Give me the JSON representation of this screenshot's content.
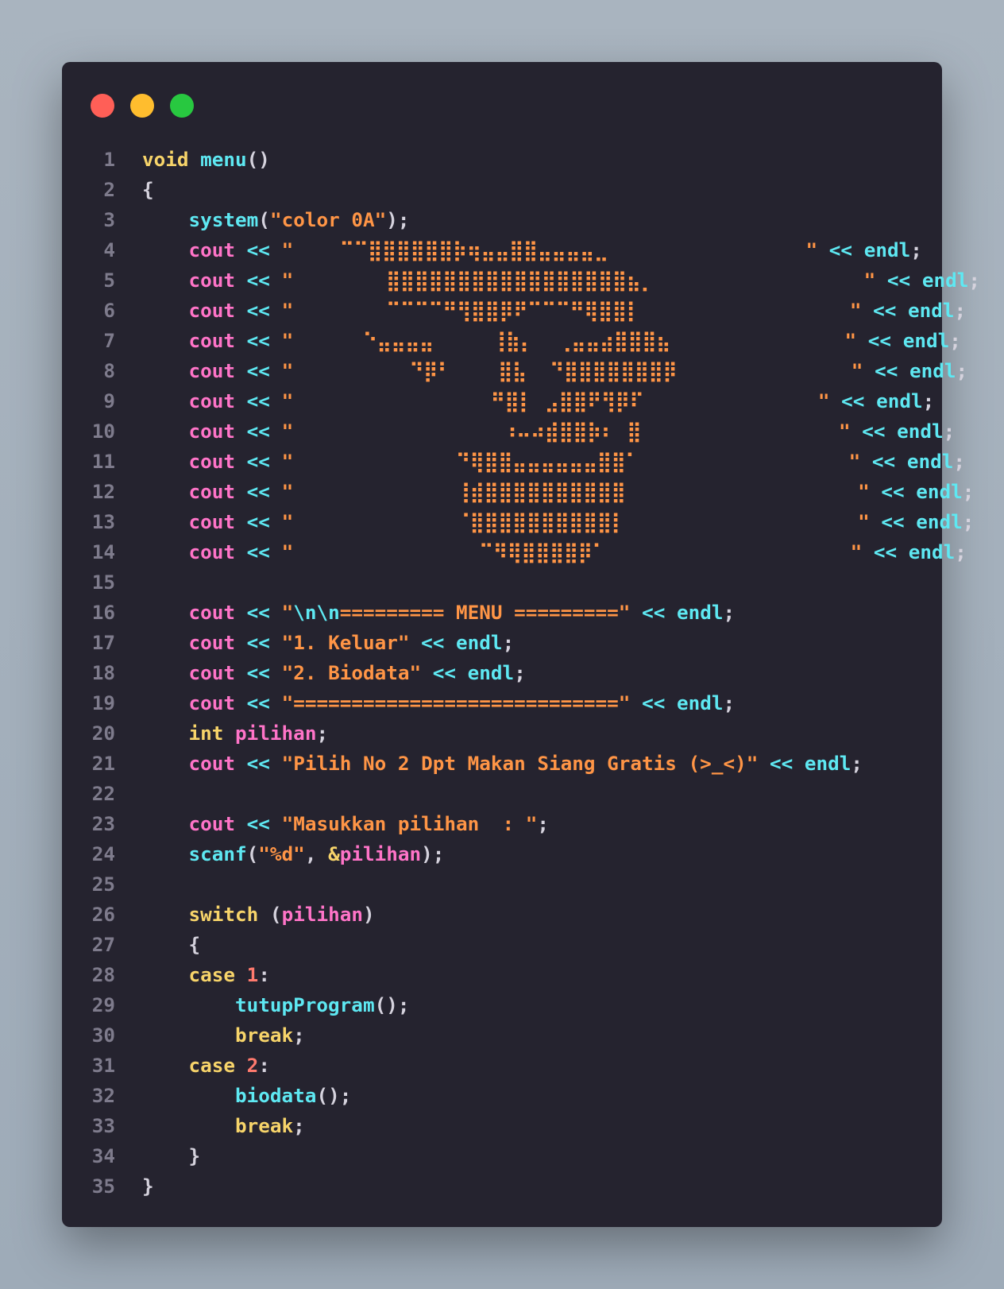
{
  "colors": {
    "background": "#a5b1bd",
    "window": "#25232f",
    "close_dot": "#ff5f57",
    "minimize_dot": "#ffbd2e",
    "zoom_dot": "#28c840",
    "keyword": "#f7d46a",
    "function": "#5ee8f2",
    "stream": "#ff74c8",
    "string": "#ff9546",
    "number": "#ff7a6e",
    "line_number": "#7e7b8c"
  },
  "code": {
    "lines": [
      {
        "n": "1",
        "t": [
          [
            "void",
            "kw"
          ],
          [
            " ",
            "pun"
          ],
          [
            "menu",
            "fn"
          ],
          [
            "()",
            "pun"
          ]
        ]
      },
      {
        "n": "2",
        "t": [
          [
            "{",
            "pun"
          ]
        ]
      },
      {
        "n": "3",
        "t": [
          [
            "    ",
            "pun"
          ],
          [
            "system",
            "fn"
          ],
          [
            "(",
            "pun"
          ],
          [
            "\"color 0A\"",
            "str"
          ],
          [
            ");",
            "pun"
          ]
        ]
      },
      {
        "n": "4",
        "t": [
          [
            "    ",
            "pun"
          ],
          [
            "cout",
            "io"
          ],
          [
            " ",
            "pun"
          ],
          [
            "<<",
            "op"
          ],
          [
            " ",
            "pun"
          ],
          [
            "\"    ⠉⠉⣿⣿⣿⣿⣿⣿⡷⢶⣤⣤⣿⣿⣤⣤⣤⣤⣀                 \"",
            "str"
          ],
          [
            " ",
            "pun"
          ],
          [
            "<<",
            "op"
          ],
          [
            " ",
            "pun"
          ],
          [
            "endl",
            "fn"
          ],
          [
            ";",
            "pun"
          ]
        ]
      },
      {
        "n": "5",
        "t": [
          [
            "    ",
            "pun"
          ],
          [
            "cout",
            "io"
          ],
          [
            " ",
            "pun"
          ],
          [
            "<<",
            "op"
          ],
          [
            " ",
            "pun"
          ],
          [
            "\"        ⣿⣿⣿⣿⣿⣿⣿⣿⣿⣿⣿⣿⣿⣿⣿⣿⣿⣦⡀                  \"",
            "str"
          ],
          [
            " ",
            "pun"
          ],
          [
            "<<",
            "op"
          ],
          [
            " ",
            "pun"
          ],
          [
            "endl",
            "fn"
          ],
          [
            ";",
            "pun"
          ]
        ]
      },
      {
        "n": "6",
        "t": [
          [
            "    ",
            "pun"
          ],
          [
            "cout",
            "io"
          ],
          [
            " ",
            "pun"
          ],
          [
            "<<",
            "op"
          ],
          [
            " ",
            "pun"
          ],
          [
            "\"        ⠉⠉⠉⠉⠛⢻⣿⣿⡿⠟⠉⠉⠉⠛⢿⣿⣿⡇                  \"",
            "str"
          ],
          [
            " ",
            "pun"
          ],
          [
            "<<",
            "op"
          ],
          [
            " ",
            "pun"
          ],
          [
            "endl",
            "fn"
          ],
          [
            ";",
            "pun"
          ]
        ]
      },
      {
        "n": "7",
        "t": [
          [
            "    ",
            "pun"
          ],
          [
            "cout",
            "io"
          ],
          [
            " ",
            "pun"
          ],
          [
            "<<",
            "op"
          ],
          [
            " ",
            "pun"
          ],
          [
            "\"      ⠑⣤⣤⣤⣤     ⢸⣷⡄  ⢀⣤⣤⣴⣿⣿⣿⣦               \"",
            "str"
          ],
          [
            " ",
            "pun"
          ],
          [
            "<<",
            "op"
          ],
          [
            " ",
            "pun"
          ],
          [
            "endl",
            "fn"
          ],
          [
            ";",
            "pun"
          ]
        ]
      },
      {
        "n": "8",
        "t": [
          [
            "    ",
            "pun"
          ],
          [
            "cout",
            "io"
          ],
          [
            " ",
            "pun"
          ],
          [
            "<<",
            "op"
          ],
          [
            " ",
            "pun"
          ],
          [
            "\"          ⠙⡿⠃    ⣿⣧  ⠙⣿⣿⣿⣿⣿⣿⣿⡿               \"",
            "str"
          ],
          [
            " ",
            "pun"
          ],
          [
            "<<",
            "op"
          ],
          [
            " ",
            "pun"
          ],
          [
            "endl",
            "fn"
          ],
          [
            ";",
            "pun"
          ]
        ]
      },
      {
        "n": "9",
        "t": [
          [
            "    ",
            "pun"
          ],
          [
            "cout",
            "io"
          ],
          [
            " ",
            "pun"
          ],
          [
            "<<",
            "op"
          ],
          [
            " ",
            "pun"
          ],
          [
            "\"                 ⠛⣿⡇ ⣠⣿⣿⠟⢻⡿⠏               \"",
            "str"
          ],
          [
            " ",
            "pun"
          ],
          [
            "<<",
            "op"
          ],
          [
            " ",
            "pun"
          ],
          [
            "endl",
            "fn"
          ],
          [
            ";",
            "pun"
          ]
        ]
      },
      {
        "n": "10",
        "t": [
          [
            "    ",
            "pun"
          ],
          [
            "cout",
            "io"
          ],
          [
            " ",
            "pun"
          ],
          [
            "<<",
            "op"
          ],
          [
            " ",
            "pun"
          ],
          [
            "\"                  ⠰⠤⠴⣾⣿⣿⡷⠆ ⣿                 \"",
            "str"
          ],
          [
            " ",
            "pun"
          ],
          [
            "<<",
            "op"
          ],
          [
            " ",
            "pun"
          ],
          [
            "endl",
            "fn"
          ],
          [
            ";",
            "pun"
          ]
        ]
      },
      {
        "n": "11",
        "t": [
          [
            "    ",
            "pun"
          ],
          [
            "cout",
            "io"
          ],
          [
            " ",
            "pun"
          ],
          [
            "<<",
            "op"
          ],
          [
            " ",
            "pun"
          ],
          [
            "\"              ⠙⢿⣿⣿⣤⣤⣤⣤⣤⣤⣿⣿⠁                  \"",
            "str"
          ],
          [
            " ",
            "pun"
          ],
          [
            "<<",
            "op"
          ],
          [
            " ",
            "pun"
          ],
          [
            "endl",
            "fn"
          ],
          [
            ";",
            "pun"
          ]
        ]
      },
      {
        "n": "12",
        "t": [
          [
            "    ",
            "pun"
          ],
          [
            "cout",
            "io"
          ],
          [
            " ",
            "pun"
          ],
          [
            "<<",
            "op"
          ],
          [
            " ",
            "pun"
          ],
          [
            "\"              ⢸⣾⣿⣿⣿⣿⣿⣿⣿⣿⣿⣿                    \"",
            "str"
          ],
          [
            " ",
            "pun"
          ],
          [
            "<<",
            "op"
          ],
          [
            " ",
            "pun"
          ],
          [
            "endl",
            "fn"
          ],
          [
            ";",
            "pun"
          ]
        ]
      },
      {
        "n": "13",
        "t": [
          [
            "    ",
            "pun"
          ],
          [
            "cout",
            "io"
          ],
          [
            " ",
            "pun"
          ],
          [
            "<<",
            "op"
          ],
          [
            " ",
            "pun"
          ],
          [
            "\"              ⠈⣿⣿⣿⣿⣿⣿⣿⣿⣿⣿⡇                    \"",
            "str"
          ],
          [
            " ",
            "pun"
          ],
          [
            "<<",
            "op"
          ],
          [
            " ",
            "pun"
          ],
          [
            "endl",
            "fn"
          ],
          [
            ";",
            "pun"
          ]
        ]
      },
      {
        "n": "14",
        "t": [
          [
            "    ",
            "pun"
          ],
          [
            "cout",
            "io"
          ],
          [
            " ",
            "pun"
          ],
          [
            "<<",
            "op"
          ],
          [
            " ",
            "pun"
          ],
          [
            "\"                ⠉⠻⢿⣿⣿⣿⣿⡿⠁                     \"",
            "str"
          ],
          [
            " ",
            "pun"
          ],
          [
            "<<",
            "op"
          ],
          [
            " ",
            "pun"
          ],
          [
            "endl",
            "fn"
          ],
          [
            ";",
            "pun"
          ]
        ]
      },
      {
        "n": "15",
        "t": []
      },
      {
        "n": "16",
        "t": [
          [
            "    ",
            "pun"
          ],
          [
            "cout",
            "io"
          ],
          [
            " ",
            "pun"
          ],
          [
            "<<",
            "op"
          ],
          [
            " ",
            "pun"
          ],
          [
            "\"",
            "str"
          ],
          [
            "\\n\\n",
            "fn"
          ],
          [
            "========= MENU =========\"",
            "str"
          ],
          [
            " ",
            "pun"
          ],
          [
            "<<",
            "op"
          ],
          [
            " ",
            "pun"
          ],
          [
            "endl",
            "fn"
          ],
          [
            ";",
            "pun"
          ]
        ]
      },
      {
        "n": "17",
        "t": [
          [
            "    ",
            "pun"
          ],
          [
            "cout",
            "io"
          ],
          [
            " ",
            "pun"
          ],
          [
            "<<",
            "op"
          ],
          [
            " ",
            "pun"
          ],
          [
            "\"1. Keluar\"",
            "str"
          ],
          [
            " ",
            "pun"
          ],
          [
            "<<",
            "op"
          ],
          [
            " ",
            "pun"
          ],
          [
            "endl",
            "fn"
          ],
          [
            ";",
            "pun"
          ]
        ]
      },
      {
        "n": "18",
        "t": [
          [
            "    ",
            "pun"
          ],
          [
            "cout",
            "io"
          ],
          [
            " ",
            "pun"
          ],
          [
            "<<",
            "op"
          ],
          [
            " ",
            "pun"
          ],
          [
            "\"2. Biodata\"",
            "str"
          ],
          [
            " ",
            "pun"
          ],
          [
            "<<",
            "op"
          ],
          [
            " ",
            "pun"
          ],
          [
            "endl",
            "fn"
          ],
          [
            ";",
            "pun"
          ]
        ]
      },
      {
        "n": "19",
        "t": [
          [
            "    ",
            "pun"
          ],
          [
            "cout",
            "io"
          ],
          [
            " ",
            "pun"
          ],
          [
            "<<",
            "op"
          ],
          [
            " ",
            "pun"
          ],
          [
            "\"============================\"",
            "str"
          ],
          [
            " ",
            "pun"
          ],
          [
            "<<",
            "op"
          ],
          [
            " ",
            "pun"
          ],
          [
            "endl",
            "fn"
          ],
          [
            ";",
            "pun"
          ]
        ]
      },
      {
        "n": "20",
        "t": [
          [
            "    ",
            "pun"
          ],
          [
            "int",
            "kw"
          ],
          [
            " ",
            "pun"
          ],
          [
            "pilihan",
            "var"
          ],
          [
            ";",
            "pun"
          ]
        ]
      },
      {
        "n": "21",
        "t": [
          [
            "    ",
            "pun"
          ],
          [
            "cout",
            "io"
          ],
          [
            " ",
            "pun"
          ],
          [
            "<<",
            "op"
          ],
          [
            " ",
            "pun"
          ],
          [
            "\"Pilih No 2 Dpt Makan Siang Gratis (>_<)\"",
            "str"
          ],
          [
            " ",
            "pun"
          ],
          [
            "<<",
            "op"
          ],
          [
            " ",
            "pun"
          ],
          [
            "endl",
            "fn"
          ],
          [
            ";",
            "pun"
          ]
        ]
      },
      {
        "n": "22",
        "t": []
      },
      {
        "n": "23",
        "t": [
          [
            "    ",
            "pun"
          ],
          [
            "cout",
            "io"
          ],
          [
            " ",
            "pun"
          ],
          [
            "<<",
            "op"
          ],
          [
            " ",
            "pun"
          ],
          [
            "\"Masukkan pilihan  : \"",
            "str"
          ],
          [
            ";",
            "pun"
          ]
        ]
      },
      {
        "n": "24",
        "t": [
          [
            "    ",
            "pun"
          ],
          [
            "scanf",
            "fn"
          ],
          [
            "(",
            "pun"
          ],
          [
            "\"%d\"",
            "str"
          ],
          [
            ", ",
            "pun"
          ],
          [
            "&",
            "kw"
          ],
          [
            "pilihan",
            "var"
          ],
          [
            ");",
            "pun"
          ]
        ]
      },
      {
        "n": "25",
        "t": []
      },
      {
        "n": "26",
        "t": [
          [
            "    ",
            "pun"
          ],
          [
            "switch",
            "kw"
          ],
          [
            " (",
            "pun"
          ],
          [
            "pilihan",
            "var"
          ],
          [
            ")",
            "pun"
          ]
        ]
      },
      {
        "n": "27",
        "t": [
          [
            "    ",
            "pun"
          ],
          [
            "{",
            "pun"
          ]
        ]
      },
      {
        "n": "28",
        "t": [
          [
            "    ",
            "pun"
          ],
          [
            "case",
            "kw"
          ],
          [
            " ",
            "pun"
          ],
          [
            "1",
            "num"
          ],
          [
            ":",
            "pun"
          ]
        ]
      },
      {
        "n": "29",
        "t": [
          [
            "        ",
            "pun"
          ],
          [
            "tutupProgram",
            "fn"
          ],
          [
            "();",
            "pun"
          ]
        ]
      },
      {
        "n": "30",
        "t": [
          [
            "        ",
            "pun"
          ],
          [
            "break",
            "kw"
          ],
          [
            ";",
            "pun"
          ]
        ]
      },
      {
        "n": "31",
        "t": [
          [
            "    ",
            "pun"
          ],
          [
            "case",
            "kw"
          ],
          [
            " ",
            "pun"
          ],
          [
            "2",
            "num"
          ],
          [
            ":",
            "pun"
          ]
        ]
      },
      {
        "n": "32",
        "t": [
          [
            "        ",
            "pun"
          ],
          [
            "biodata",
            "fn"
          ],
          [
            "();",
            "pun"
          ]
        ]
      },
      {
        "n": "33",
        "t": [
          [
            "        ",
            "pun"
          ],
          [
            "break",
            "kw"
          ],
          [
            ";",
            "pun"
          ]
        ]
      },
      {
        "n": "34",
        "t": [
          [
            "    ",
            "pun"
          ],
          [
            "}",
            "pun"
          ]
        ]
      },
      {
        "n": "35",
        "t": [
          [
            "}",
            "pun"
          ]
        ]
      }
    ]
  }
}
